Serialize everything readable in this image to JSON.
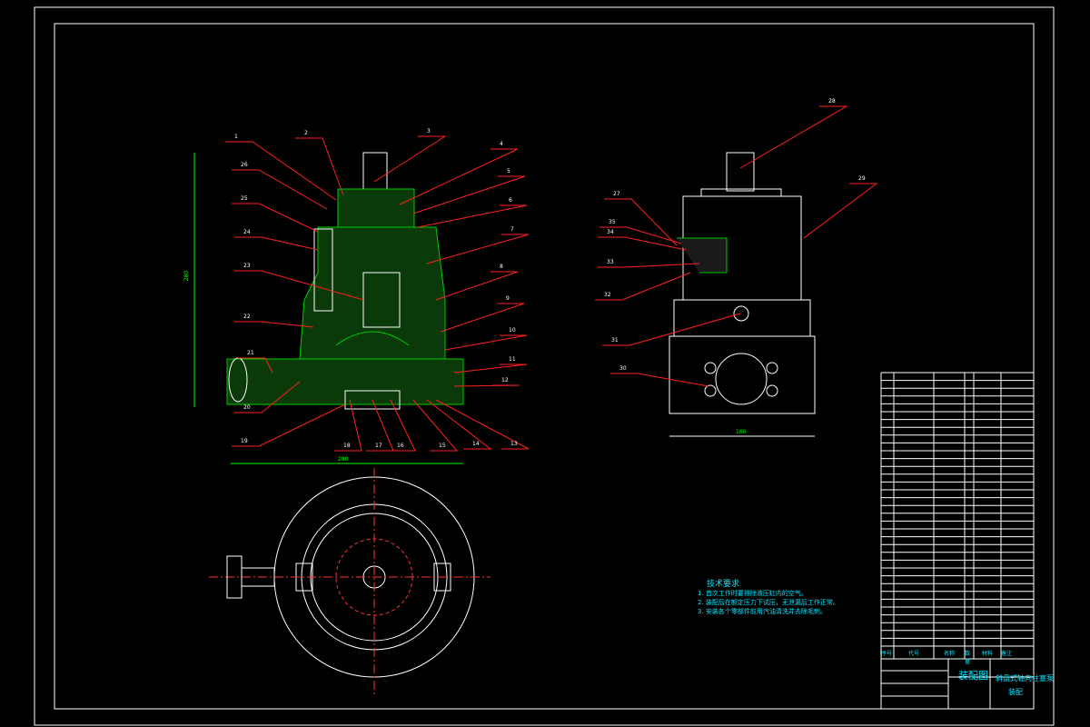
{
  "drawing": {
    "colors": {
      "background": "#000000",
      "outline": "#ffffff",
      "leader": "#ff2020",
      "section": "#00c000",
      "text": "#00e5ff",
      "dimension": "#00ff00"
    },
    "front_view_labels": [
      "1",
      "2",
      "3",
      "4",
      "5",
      "6",
      "7",
      "8",
      "9",
      "10",
      "11",
      "12",
      "13",
      "14",
      "15",
      "16",
      "17",
      "18",
      "19",
      "20",
      "21",
      "22",
      "23",
      "24",
      "25",
      "26"
    ],
    "side_view_labels": [
      "28",
      "29",
      "27",
      "35",
      "34",
      "33",
      "32",
      "31",
      "30"
    ],
    "dimensions": {
      "height": "280",
      "width": "280",
      "side_width": "160"
    }
  },
  "tech_requirements": {
    "title": "技术要求",
    "lines": [
      "1. 首次工作时要排除液压缸内的空气。",
      "2. 装配后在额定压力下试压，无泄漏后工作正常。",
      "3. 安装各个零部件前用汽油清洗并去除毛刺。"
    ]
  },
  "parts_list": {
    "headers": [
      "序号",
      "代号",
      "名称",
      "数量",
      "材料",
      "备注"
    ]
  },
  "title_block": {
    "drawing_type": "装配图",
    "product_name": "斜盘式轴向柱塞泵",
    "sub_name": "装配"
  }
}
